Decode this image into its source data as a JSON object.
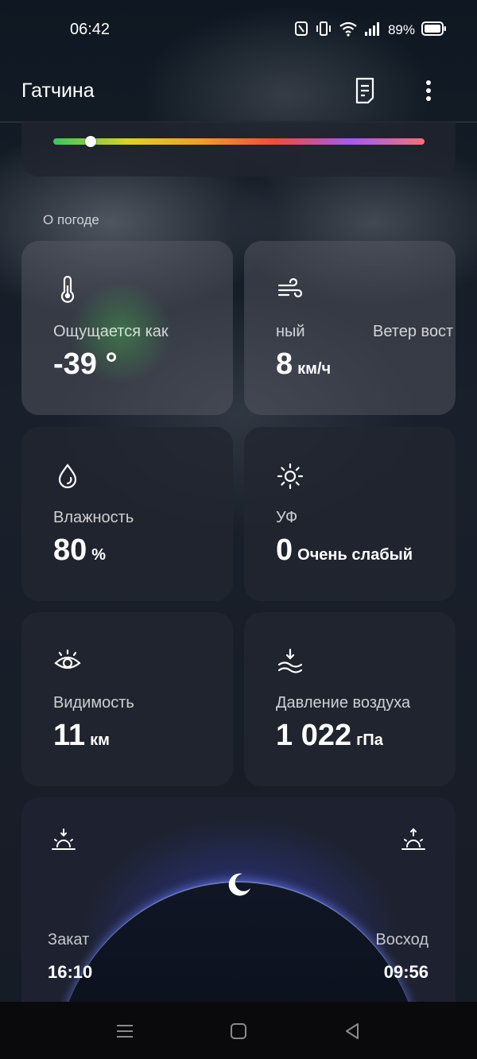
{
  "status": {
    "time": "06:42",
    "battery": "89%"
  },
  "header": {
    "city": "Гатчина"
  },
  "aqi": {
    "level": 0.1
  },
  "section": {
    "title": "О погоде"
  },
  "cards": {
    "feels_like": {
      "label": "Ощущается как",
      "value": "-39 °",
      "unit": ""
    },
    "wind": {
      "label": "ный",
      "label_2": "Ветер вост",
      "value": "8",
      "unit": "км/ч"
    },
    "humidity": {
      "label": "Влажность",
      "value": "80",
      "unit": "%"
    },
    "uv": {
      "label": "УФ",
      "value": "0",
      "unit": "Очень слабый"
    },
    "visibility": {
      "label": "Видимость",
      "value": "11",
      "unit": "км"
    },
    "pressure": {
      "label": "Давление воздуха",
      "value": "1 022",
      "unit": "гПа"
    }
  },
  "sun": {
    "sunset_label": "Закат",
    "sunset_time": "16:10",
    "sunrise_label": "Восход",
    "sunrise_time": "09:56"
  }
}
